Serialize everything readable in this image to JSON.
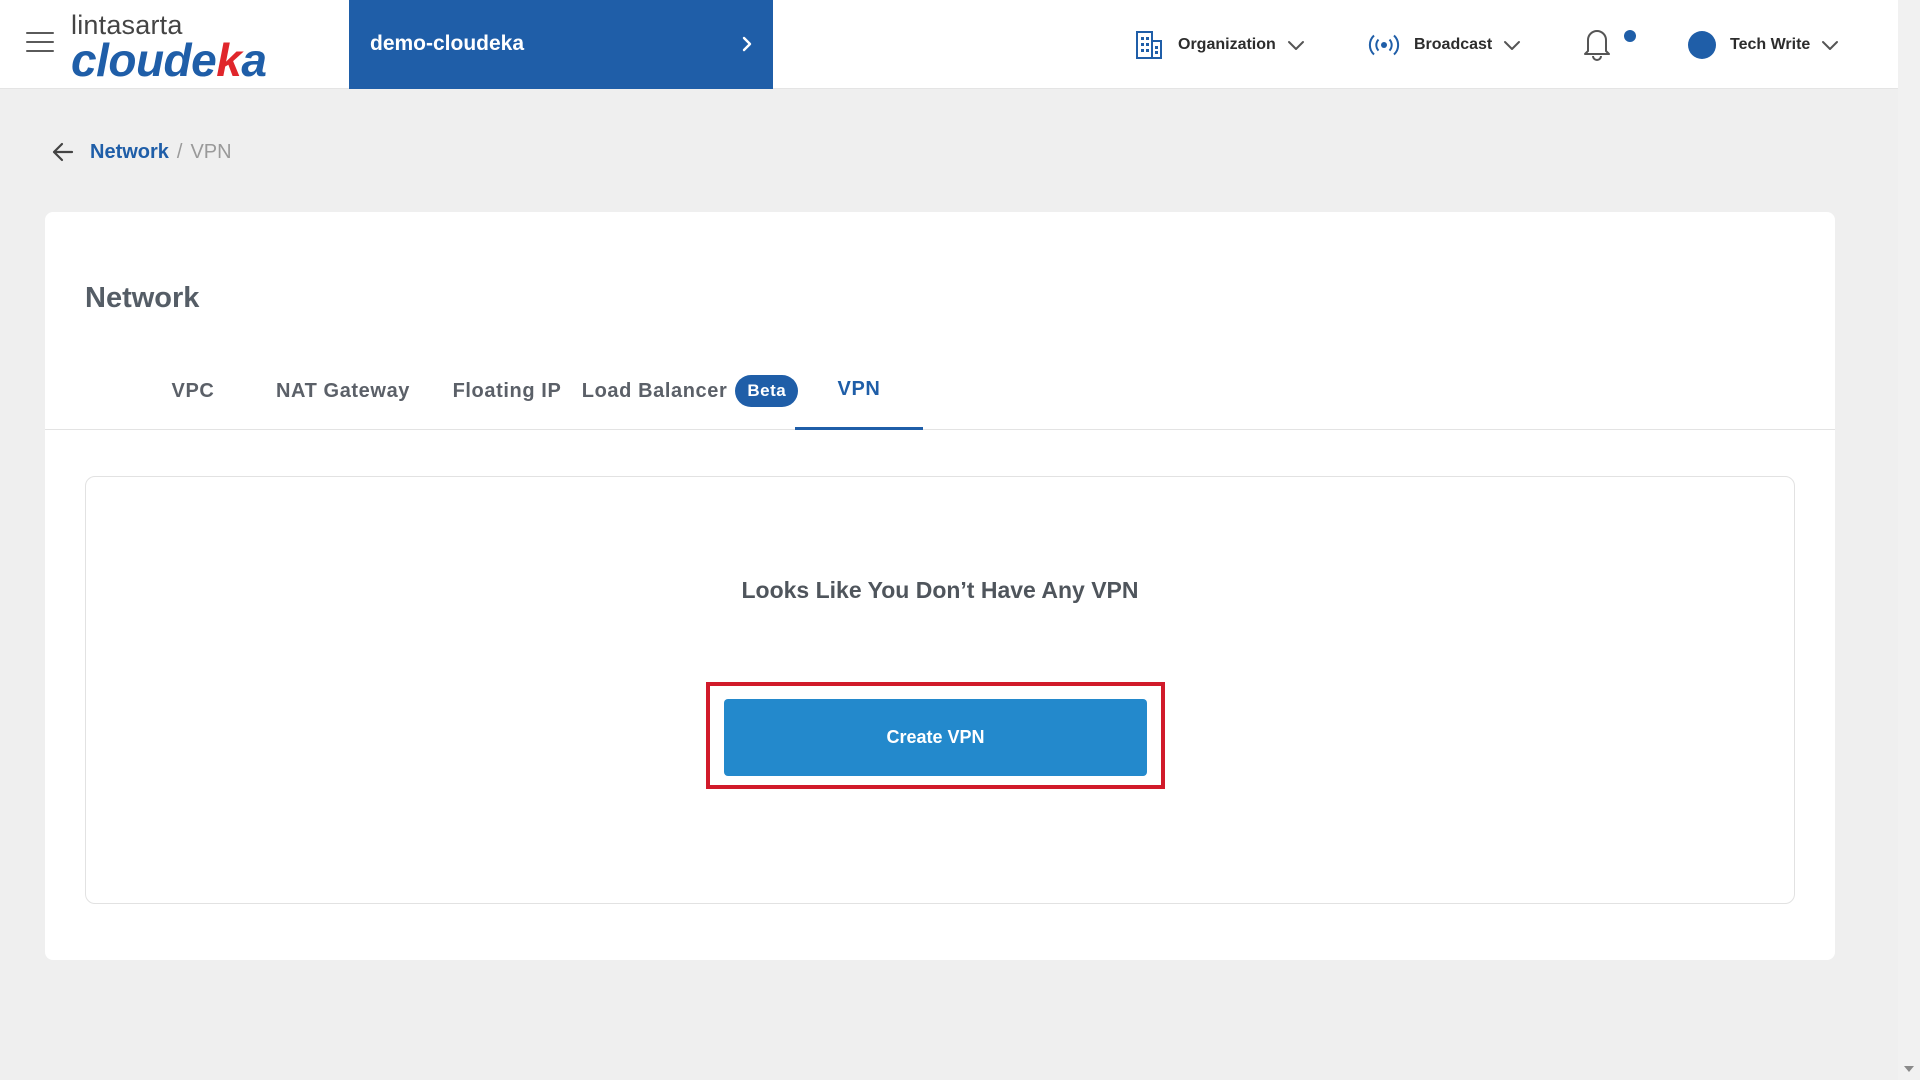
{
  "brand": {
    "logo_top": "lintasarta",
    "logo_bottom_pre": "cloude",
    "logo_bottom_accent": "k",
    "logo_bottom_post": "a"
  },
  "header": {
    "project_name": "demo-cloudeka",
    "organization_label": "Organization",
    "broadcast_label": "Broadcast",
    "user_name": "Tech Write"
  },
  "breadcrumb": {
    "parent": "Network",
    "separator": "/",
    "current": "VPN"
  },
  "page": {
    "title": "Network",
    "tabs": [
      {
        "label": "VPC"
      },
      {
        "label": "NAT Gateway"
      },
      {
        "label": "Floating IP"
      },
      {
        "label": "Load Balancer",
        "badge": "Beta"
      },
      {
        "label": "VPN",
        "active": true
      }
    ]
  },
  "empty_state": {
    "message": "Looks Like You Don’t Have Any VPN",
    "button_label": "Create VPN"
  },
  "colors": {
    "brand_blue": "#1f5ea8",
    "button_blue": "#2389cc",
    "highlight_red": "#d11a2a",
    "logo_accent_red": "#e0262b"
  }
}
